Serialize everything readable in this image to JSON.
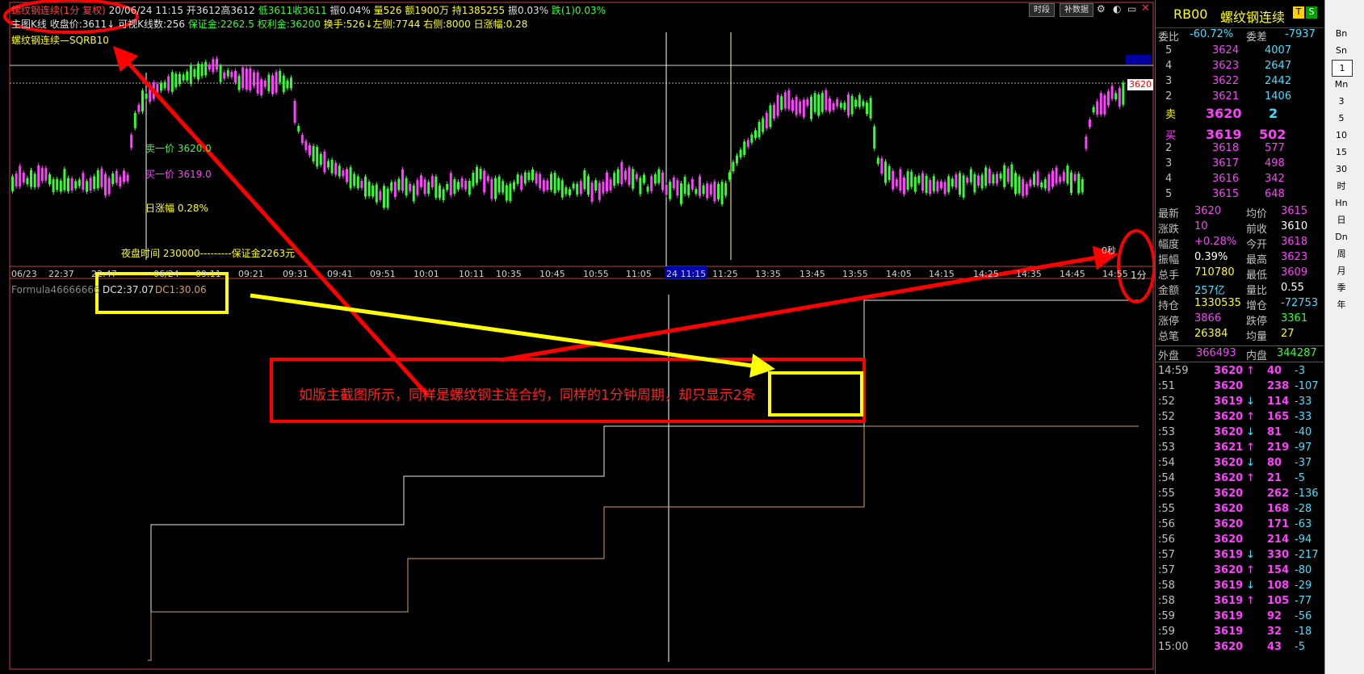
{
  "header": {
    "line1_title": "螺纹钢连续(1分 复权)",
    "line1_date": "20/06/24 11:15",
    "line1_open": "开3612",
    "line1_high": "高3612",
    "line1_low": "低3611",
    "line1_close": "收3611",
    "line1_amp": "振0.04%",
    "line1_vol": "量526",
    "line1_amount": "额1900万",
    "line1_hold": "持1385255",
    "line1_swing": "振0.03%",
    "line1_fall": "跌(1)0.03%",
    "line2_main": "主图K线",
    "line2_close": "收盘价:3611↓",
    "line2_visible": "可视K线数:256",
    "line2_margin": "保证金:2262.5",
    "line2_profit": "权利金:36200",
    "line2_turnover": "换手:526↓",
    "line2_left": "左侧:7744",
    "line2_right": "右侧:8000",
    "line2_daychange": "日涨幅:0.28",
    "contract_label": "螺纹钢连续—SQRB10",
    "btn_timeshare": "时段",
    "btn_data": "补数据",
    "price_tag": "3620",
    "second_label": "0秒",
    "period_label": "1分"
  },
  "overlay": {
    "sell1": "卖一价 3620.0",
    "buy1": "买一价 3619.0",
    "daychange": "日涨幅  0.28%",
    "night": "夜盘时间 230000---------保证金2263元"
  },
  "time_axis": [
    "06/23",
    "22:37",
    "22:47",
    "06/24",
    "09:11",
    "09:21",
    "09:31",
    "09:41",
    "09:51",
    "10:01",
    "10:11",
    "10:35",
    "10:45",
    "10:55",
    "11:05",
    "24 11:15",
    "11:25",
    "13:35",
    "13:45",
    "13:55",
    "14:05",
    "14:15",
    "14:25",
    "14:35",
    "14:45",
    "14:55"
  ],
  "sub_chart": {
    "formula": "Formula46666666",
    "dc2": "DC2:37.07",
    "dc1": "DC1:30.06"
  },
  "annotation": {
    "text": "如版主截图所示，同样是螺纹钢主连合约，同样的1分钟周期，却只显示2条"
  },
  "right_panel": {
    "code": "RB00",
    "name": "螺纹钢连续",
    "ratio_label": "委比",
    "ratio_val": "-60.72%",
    "diff_label": "委差",
    "diff_val": "-7937",
    "sell": [
      {
        "lvl": "5",
        "price": "3624",
        "vol": "4007"
      },
      {
        "lvl": "4",
        "price": "3623",
        "vol": "2647"
      },
      {
        "lvl": "3",
        "price": "3622",
        "vol": "2442"
      },
      {
        "lvl": "2",
        "price": "3621",
        "vol": "1406"
      },
      {
        "lvl": "卖",
        "price": "3620",
        "vol": "2"
      }
    ],
    "buy": [
      {
        "lvl": "买",
        "price": "3619",
        "vol": "502"
      },
      {
        "lvl": "2",
        "price": "3618",
        "vol": "577"
      },
      {
        "lvl": "3",
        "price": "3617",
        "vol": "498"
      },
      {
        "lvl": "4",
        "price": "3616",
        "vol": "342"
      },
      {
        "lvl": "5",
        "price": "3615",
        "vol": "648"
      }
    ],
    "stats": [
      {
        "l1": "最新",
        "v1": "3620",
        "l2": "均价",
        "v2": "3615"
      },
      {
        "l1": "涨跌",
        "v1": "10",
        "l2": "前收",
        "v2": "3610"
      },
      {
        "l1": "幅度",
        "v1": "+0.28%",
        "l2": "今开",
        "v2": "3618"
      },
      {
        "l1": "振幅",
        "v1": "0.39%",
        "l2": "最高",
        "v2": "3623"
      },
      {
        "l1": "总手",
        "v1": "710780",
        "l2": "最低",
        "v2": "3609"
      },
      {
        "l1": "金额",
        "v1": "257亿",
        "l2": "量比",
        "v2": "0.55"
      },
      {
        "l1": "持仓",
        "v1": "1330535",
        "l2": "增仓",
        "v2": "-72753"
      },
      {
        "l1": "涨停",
        "v1": "3866",
        "l2": "跌停",
        "v2": "3361"
      },
      {
        "l1": "总笔",
        "v1": "26384",
        "l2": "均量",
        "v2": "27"
      }
    ],
    "outer_label": "外盘",
    "outer_val": "366493",
    "inner_label": "内盘",
    "inner_val": "344287",
    "ticks": [
      {
        "t": "14:59",
        "p": "3620",
        "a": "↑",
        "v": "40",
        "d": "-3"
      },
      {
        "t": ":51",
        "p": "3620",
        "a": "",
        "v": "238",
        "d": "-107"
      },
      {
        "t": ":52",
        "p": "3619",
        "a": "↓",
        "v": "114",
        "d": "-33"
      },
      {
        "t": ":52",
        "p": "3620",
        "a": "↑",
        "v": "165",
        "d": "-33"
      },
      {
        "t": ":53",
        "p": "3620",
        "a": "↓",
        "v": "81",
        "d": "-40"
      },
      {
        "t": ":53",
        "p": "3621",
        "a": "↑",
        "v": "219",
        "d": "-97"
      },
      {
        "t": ":54",
        "p": "3620",
        "a": "↓",
        "v": "80",
        "d": "-37"
      },
      {
        "t": ":54",
        "p": "3620",
        "a": "↑",
        "v": "21",
        "d": "-5"
      },
      {
        "t": ":55",
        "p": "3620",
        "a": "",
        "v": "262",
        "d": "-136"
      },
      {
        "t": ":55",
        "p": "3620",
        "a": "",
        "v": "168",
        "d": "-28"
      },
      {
        "t": ":56",
        "p": "3620",
        "a": "",
        "v": "171",
        "d": "-63"
      },
      {
        "t": ":56",
        "p": "3620",
        "a": "",
        "v": "214",
        "d": "-94"
      },
      {
        "t": ":57",
        "p": "3619",
        "a": "↓",
        "v": "330",
        "d": "-217"
      },
      {
        "t": ":57",
        "p": "3620",
        "a": "↑",
        "v": "154",
        "d": "-80"
      },
      {
        "t": ":58",
        "p": "3619",
        "a": "↓",
        "v": "108",
        "d": "-29"
      },
      {
        "t": ":58",
        "p": "3619",
        "a": "↑",
        "v": "105",
        "d": "-77"
      },
      {
        "t": ":59",
        "p": "3619",
        "a": "",
        "v": "92",
        "d": "-56"
      },
      {
        "t": ":59",
        "p": "3619",
        "a": "",
        "v": "32",
        "d": "-18"
      },
      {
        "t": "15:00",
        "p": "3620",
        "a": "",
        "v": "43",
        "d": "-5"
      }
    ]
  },
  "sidebar": [
    "Bn",
    "Sn",
    "1",
    "Mn",
    "3",
    "5",
    "10",
    "15",
    "30",
    "时",
    "Hn",
    "日",
    "Dn",
    "周",
    "月",
    "季",
    "年"
  ],
  "colors": {
    "up": "#ff40ff",
    "down": "#33ff33",
    "annot": "#ff0000",
    "highlight": "#ffff00"
  }
}
